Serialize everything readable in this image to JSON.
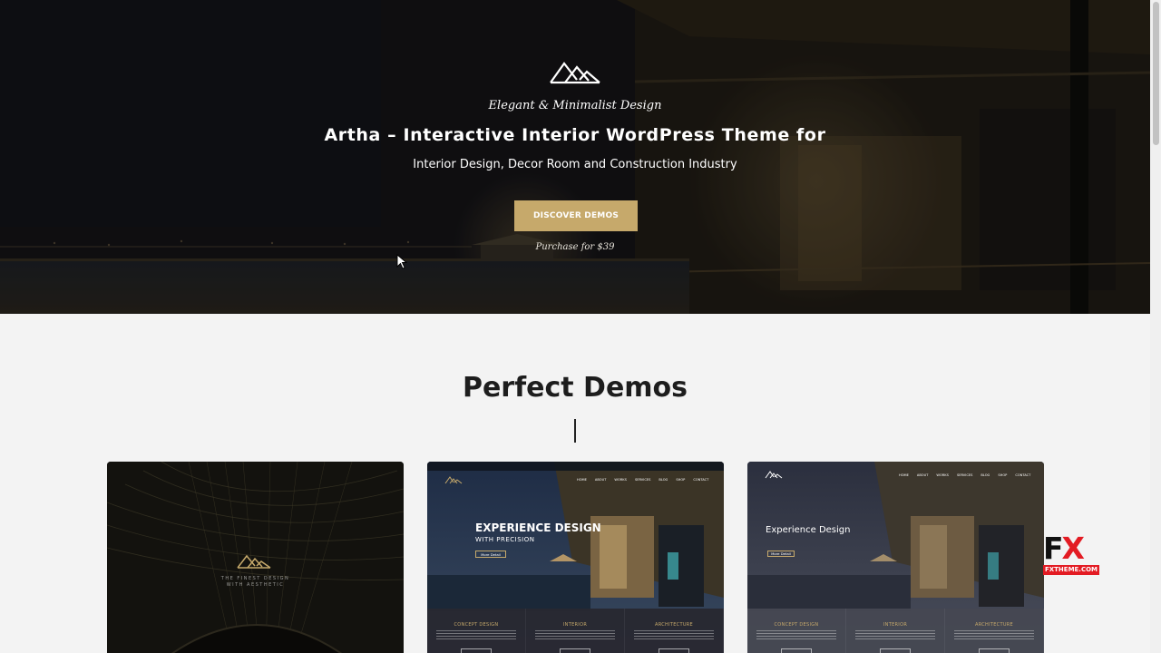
{
  "hero": {
    "tagline": "Elegant & Minimalist Design",
    "title": "Artha – Interactive Interior WordPress Theme for",
    "subtitle": "Interior Design, Decor Room and Construction Industry",
    "cta_label": "DISCOVER DEMOS",
    "purchase_text": "Purchase for $39"
  },
  "section": {
    "title": "Perfect Demos"
  },
  "demos": [
    {
      "line1": "THE FINEST DESIGN",
      "line2": "WITH AESTHETIC"
    },
    {
      "headline": "EXPERIENCE DESIGN",
      "sub": "WITH PRECISION",
      "button": "More Detail",
      "nav": [
        "HOME",
        "ABOUT",
        "WORKS",
        "SERVICES",
        "BLOG",
        "SHOP",
        "CONTACT"
      ],
      "strip": [
        "CONCEPT DESIGN",
        "INTERIOR",
        "ARCHITECTURE"
      ]
    },
    {
      "headline": "Experience Design",
      "button": "More Detail",
      "nav": [
        "HOME",
        "ABOUT",
        "WORKS",
        "SERVICES",
        "BLOG",
        "SHOP",
        "CONTACT"
      ],
      "strip": [
        "CONCEPT DESIGN",
        "INTERIOR",
        "ARCHITECTURE"
      ]
    }
  ],
  "badge": {
    "letters_f": "F",
    "letters_x": "X",
    "url": "FXTHEME.COM"
  },
  "colors": {
    "accent": "#c6a96b",
    "badge_red": "#e31b23"
  }
}
